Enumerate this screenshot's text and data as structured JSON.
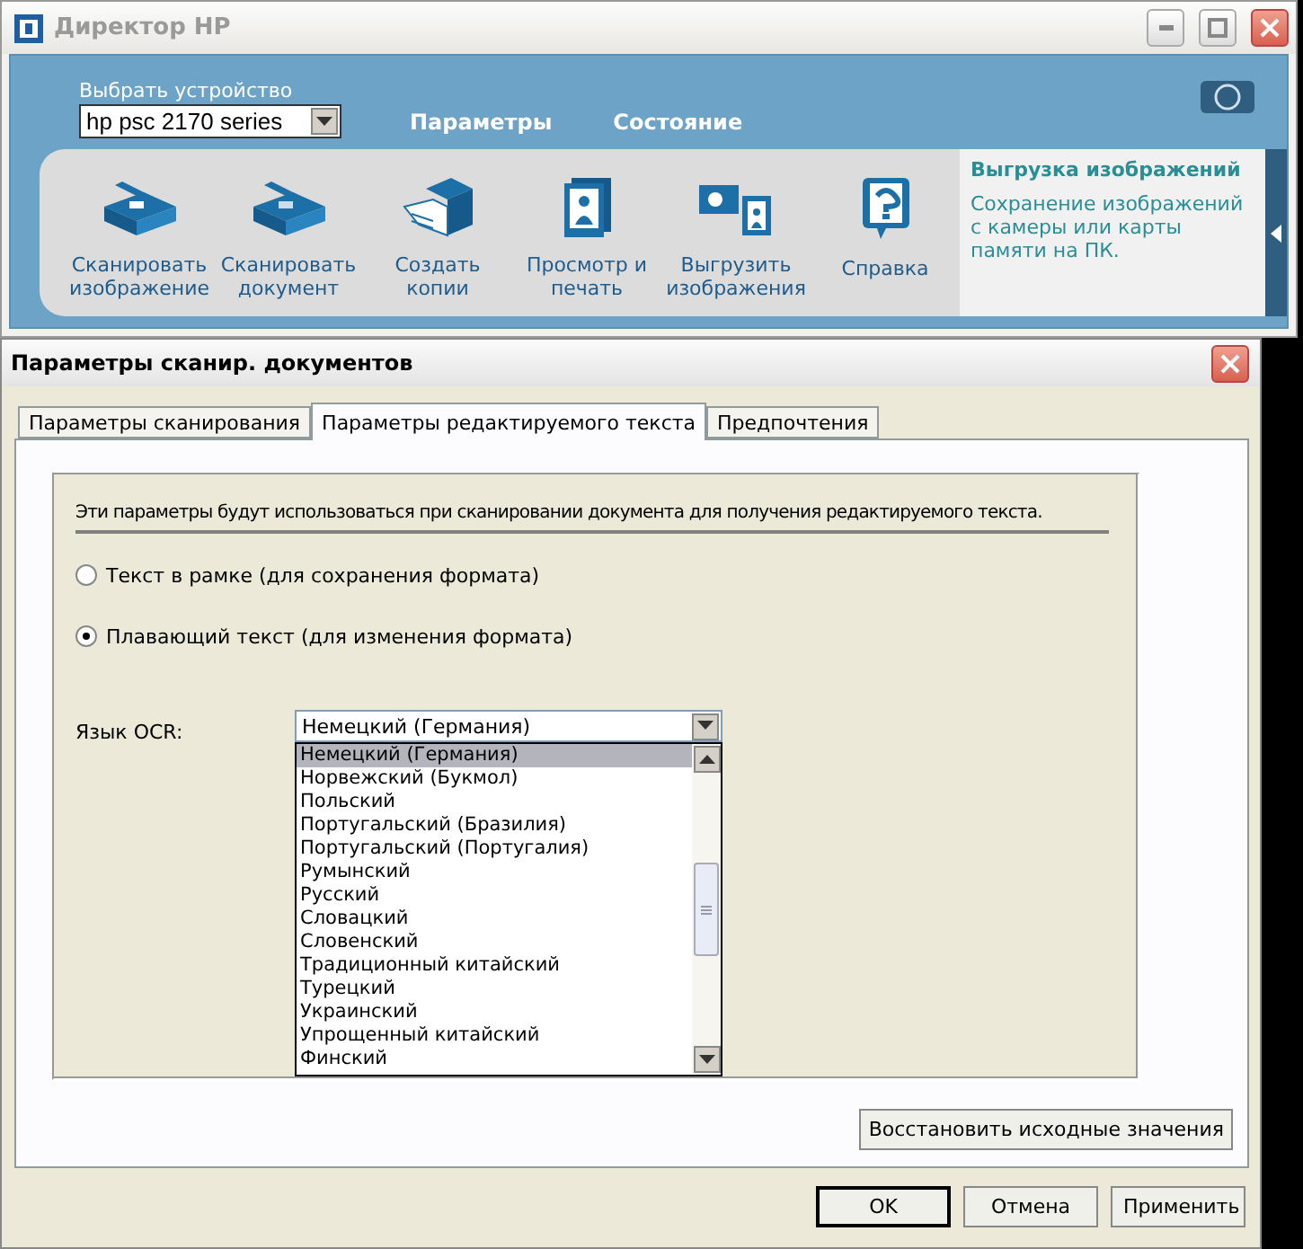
{
  "hp_window": {
    "title": "Директор HP",
    "device_label": "Выбрать устройство",
    "device_value": "hp psc 2170 series",
    "nav": [
      {
        "label": "Параметры"
      },
      {
        "label": "Состояние"
      }
    ],
    "tools": [
      {
        "kind": "scan-image",
        "lines": [
          "Сканировать",
          "изображение"
        ]
      },
      {
        "kind": "scan-document",
        "lines": [
          "Сканировать",
          "документ"
        ]
      },
      {
        "kind": "copy",
        "lines": [
          "Создать",
          "копии"
        ]
      },
      {
        "kind": "view",
        "lines": [
          "Просмотр и",
          "печать"
        ]
      },
      {
        "kind": "unload",
        "lines": [
          "Выгрузить",
          "изображения"
        ]
      },
      {
        "kind": "help",
        "lines": [
          "Справка"
        ]
      }
    ],
    "info": {
      "title": "Выгрузка изображений",
      "text": "Сохранение изображений с камеры или карты памяти на ПК."
    }
  },
  "dialog": {
    "title": "Параметры сканир. документов",
    "tabs": [
      {
        "label": "Параметры сканирования",
        "selected": false
      },
      {
        "label": "Параметры редактируемого текста",
        "selected": true
      },
      {
        "label": "Предпочтения",
        "selected": false
      }
    ],
    "intro": "Эти параметры будут использоваться при сканировании документа для получения редактируемого текста.",
    "options": [
      {
        "label": "Текст в рамке (для сохранения формата)",
        "selected": false
      },
      {
        "label": "Плавающий текст (для изменения формата)",
        "selected": true
      }
    ],
    "ocr_label": "Язык OCR:",
    "ocr_value": "Немецкий (Германия)",
    "languages": [
      {
        "label": "Немецкий (Германия)",
        "selected": true
      },
      {
        "label": "Норвежский (Букмол)",
        "selected": false
      },
      {
        "label": "Польский",
        "selected": false
      },
      {
        "label": "Португальский (Бразилия)",
        "selected": false
      },
      {
        "label": "Португальский (Португалия)",
        "selected": false
      },
      {
        "label": "Румынский",
        "selected": false
      },
      {
        "label": "Русский",
        "selected": false
      },
      {
        "label": "Словацкий",
        "selected": false
      },
      {
        "label": "Словенский",
        "selected": false
      },
      {
        "label": "Традиционный китайский",
        "selected": false
      },
      {
        "label": "Турецкий",
        "selected": false
      },
      {
        "label": "Украинский",
        "selected": false
      },
      {
        "label": "Упрощенный китайский",
        "selected": false
      },
      {
        "label": "Финский",
        "selected": false
      }
    ],
    "restore": "Восстановить исходные значения",
    "buttons": [
      {
        "label": "OK"
      },
      {
        "label": "Отмена"
      },
      {
        "label": "Применить"
      }
    ]
  }
}
